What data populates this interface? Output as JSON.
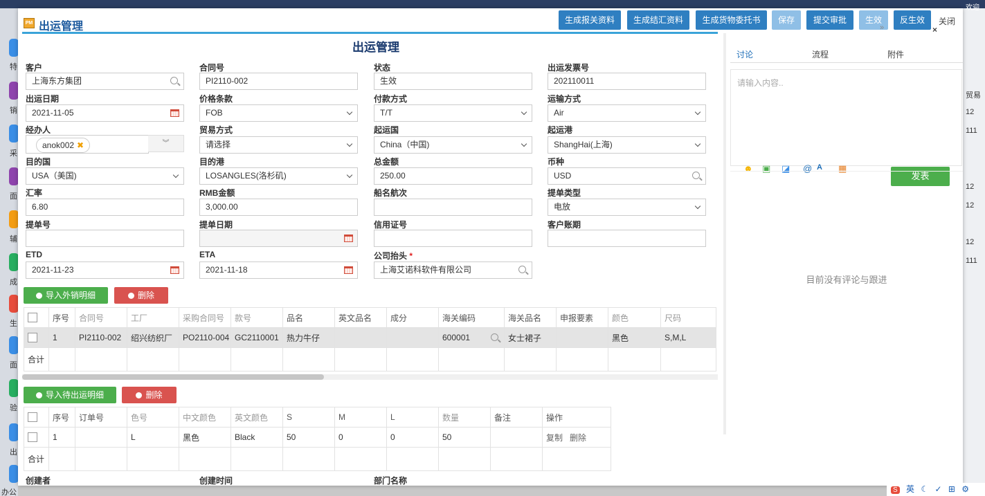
{
  "window": {
    "title": "出运管理"
  },
  "toolbar": {
    "buttons": [
      "生成报关资料",
      "生成结汇资料",
      "生成货物委托书",
      "保存",
      "提交审批",
      "生效",
      "反生效"
    ],
    "close": "关闭"
  },
  "form": {
    "title": "出运管理",
    "fields": {
      "customer": {
        "label": "客户",
        "value": "上海东方集团"
      },
      "contract_no": {
        "label": "合同号",
        "value": "PI2110-002"
      },
      "status": {
        "label": "状态",
        "value": "生效"
      },
      "invoice_no": {
        "label": "出运发票号",
        "value": "202110011"
      },
      "ship_date": {
        "label": "出运日期",
        "value": "2021-11-05"
      },
      "price_term": {
        "label": "价格条款",
        "value": "FOB"
      },
      "payment": {
        "label": "付款方式",
        "value": "T/T"
      },
      "transport": {
        "label": "运输方式",
        "value": "Air"
      },
      "handler": {
        "label": "经办人",
        "value": "anok002"
      },
      "trade_mode": {
        "label": "贸易方式",
        "value": "请选择"
      },
      "origin_country": {
        "label": "起运国",
        "value": "China（中国)"
      },
      "origin_port": {
        "label": "起运港",
        "value": "ShangHai(上海)"
      },
      "dest_country": {
        "label": "目的国",
        "value": "USA（美国)"
      },
      "dest_port": {
        "label": "目的港",
        "value": "LOSANGLES(洛杉矶)"
      },
      "total_amount": {
        "label": "总金额",
        "value": "250.00"
      },
      "currency": {
        "label": "币种",
        "value": "USD"
      },
      "exchange_rate": {
        "label": "汇率",
        "value": "6.80"
      },
      "rmb_amount": {
        "label": "RMB金额",
        "value": "3,000.00"
      },
      "vessel": {
        "label": "船名航次",
        "value": ""
      },
      "bl_type": {
        "label": "提单类型",
        "value": "电放"
      },
      "bl_no": {
        "label": "提单号",
        "value": ""
      },
      "bl_date": {
        "label": "提单日期",
        "value": ""
      },
      "lc_no": {
        "label": "信用证号",
        "value": ""
      },
      "customer_term": {
        "label": "客户账期",
        "value": ""
      },
      "etd": {
        "label": "ETD",
        "value": "2021-11-23"
      },
      "eta": {
        "label": "ETA",
        "value": "2021-11-18"
      },
      "company_header": {
        "label": "公司抬头",
        "value": "上海艾诺科软件有限公司"
      }
    },
    "footer_labels": {
      "creator": "创建者",
      "created_time": "创建时间",
      "dept": "部门名称"
    }
  },
  "table1": {
    "import_button": "导入外销明细",
    "delete_button": "删除",
    "headers": [
      "序号",
      "合同号",
      "工厂",
      "采购合同号",
      "款号",
      "品名",
      "英文品名",
      "成分",
      "海关编码",
      "海关品名",
      "申报要素",
      "颜色",
      "尺码"
    ],
    "rows": [
      [
        "1",
        "PI2110-002",
        "绍兴纺织厂",
        "PO2110-004",
        "GC2110001",
        "热力牛仔",
        "",
        "",
        "600001",
        "女士裙子",
        "",
        "黑色",
        "S,M,L"
      ]
    ],
    "total_label": "合计"
  },
  "table2": {
    "import_button": "导入待出运明细",
    "delete_button": "删除",
    "headers": [
      "序号",
      "订单号",
      "色号",
      "中文颜色",
      "英文颜色",
      "S",
      "M",
      "L",
      "数量",
      "备注",
      "操作"
    ],
    "rows": [
      [
        "1",
        "",
        "L",
        "黑色",
        "Black",
        "50",
        "0",
        "0",
        "50",
        ""
      ]
    ],
    "row_actions": [
      "复制",
      "删除"
    ],
    "total_label": "合计"
  },
  "panel": {
    "tabs": [
      "讨论",
      "流程",
      "附件"
    ],
    "placeholder": "请输入内容..",
    "send": "发表",
    "empty": "目前没有评论与跟进"
  },
  "background": {
    "top_right": "欢迎",
    "side_labels": [
      "特",
      "销",
      "采",
      "面",
      "辅",
      "成",
      "生",
      "面",
      "验",
      "出",
      "办公"
    ],
    "right_labels": [
      "贸易",
      "12",
      "111",
      "12",
      "12",
      "12",
      "111"
    ]
  },
  "tray": {
    "items": [
      "英",
      "✓",
      "⊞",
      "⚙"
    ]
  }
}
